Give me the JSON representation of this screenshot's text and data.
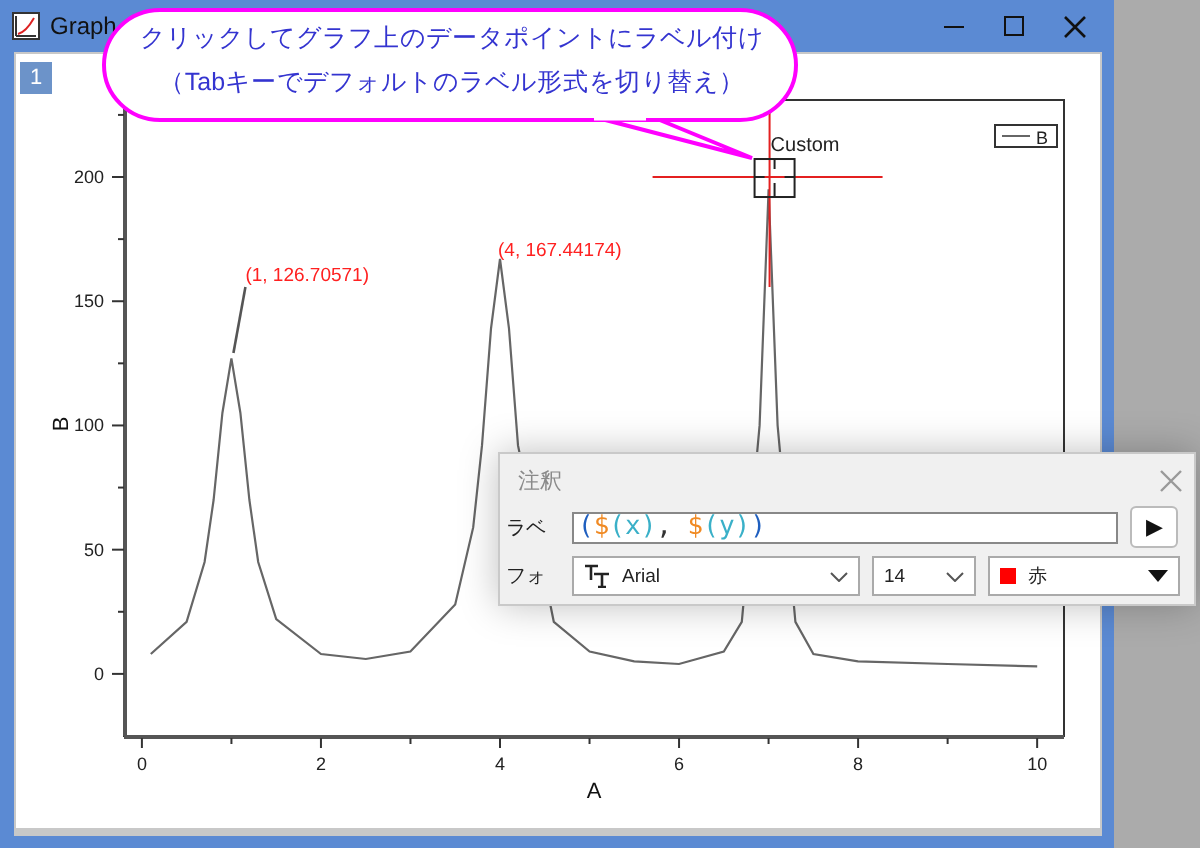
{
  "window": {
    "title": "Graph"
  },
  "page_tab": "1",
  "chart_data": {
    "type": "line",
    "xlabel": "A",
    "ylabel": "B",
    "x": [
      0.1,
      0.5,
      0.7,
      0.8,
      0.9,
      1,
      1.1,
      1.2,
      1.3,
      1.5,
      2,
      2.5,
      3,
      3.5,
      3.7,
      3.8,
      3.9,
      4,
      4.1,
      4.2,
      4.6,
      5,
      5.5,
      6,
      6.5,
      6.7,
      6.9,
      7,
      7.1,
      7.3,
      7.5,
      8,
      9,
      10
    ],
    "series": [
      {
        "name": "B",
        "color": "#666666",
        "values": [
          8,
          21,
          45,
          70,
          105,
          127,
          105,
          70,
          45,
          22,
          8,
          6,
          9,
          28,
          59,
          92,
          139,
          167,
          139,
          92,
          21,
          9,
          5,
          4,
          9,
          21,
          100,
          195,
          100,
          21,
          8,
          5,
          4,
          3
        ]
      }
    ],
    "xlim": [
      -0.2,
      10.3
    ],
    "ylim": [
      -25,
      231
    ],
    "xticks": [
      0,
      2,
      4,
      6,
      8,
      10
    ],
    "yticks": [
      0,
      50,
      100,
      150,
      200
    ],
    "annotations": [
      {
        "x": 1,
        "y": 126.70571,
        "text": "(1, 126.70571)"
      },
      {
        "x": 4,
        "y": 167.44174,
        "text": "(4, 167.44174)"
      }
    ]
  },
  "cursor": {
    "label": "Custom"
  },
  "callout": {
    "lines": [
      "クリックしてグラフ上のデータポイントにラベル付け",
      "（Tabキーでデフォルトのラベル形式を切り替え）"
    ]
  },
  "dialog": {
    "title": "注釈",
    "label_row": {
      "label": "ラベ",
      "value": "($(x), $(y))",
      "button": "▶"
    },
    "font_row": {
      "label": "フォ",
      "font": "Arial",
      "size": "14",
      "color_name": "赤",
      "color": "#ff0000"
    }
  }
}
